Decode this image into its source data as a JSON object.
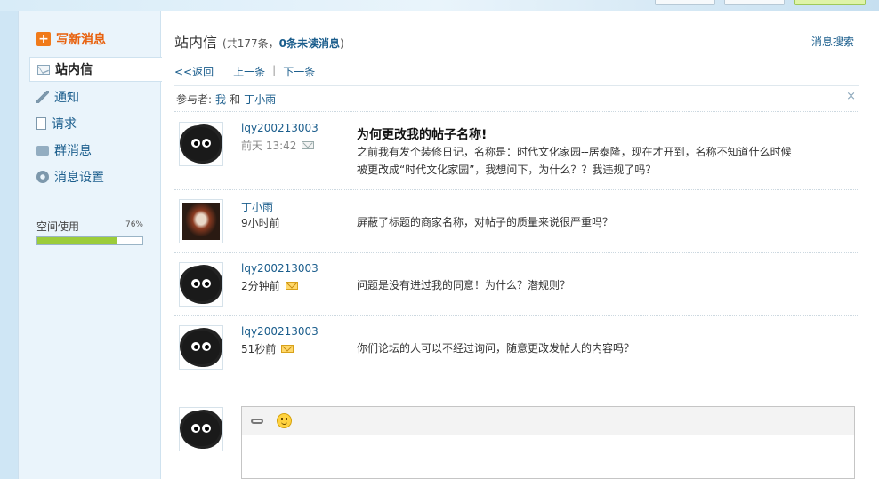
{
  "sidebar": {
    "compose_label": "写新消息",
    "items": [
      {
        "label": "站内信",
        "icon": "mail-icon",
        "active": true
      },
      {
        "label": "通知",
        "icon": "pencil-icon"
      },
      {
        "label": "请求",
        "icon": "document-icon"
      },
      {
        "label": "群消息",
        "icon": "chat-icon"
      },
      {
        "label": "消息设置",
        "icon": "settings-icon"
      }
    ],
    "usage": {
      "label": "空间使用",
      "percent_text": "76%",
      "percent": 0.76
    }
  },
  "main": {
    "title": "站内信",
    "count_prefix": "(共177条，",
    "unread_text": "0条未读消息",
    "count_suffix": ")",
    "search_link": "消息搜索",
    "pager": {
      "back": "<<返回",
      "prev": "上一条",
      "sep": "|",
      "next": "下一条"
    },
    "participants": {
      "label": "参与者:",
      "me": "我",
      "and": "和",
      "other": "丁小雨",
      "close": "×"
    },
    "messages": [
      {
        "sender": "lqy200213003",
        "time": "前天 13:42",
        "status": "read",
        "subject": "为何更改我的帖子名称!",
        "body": "之前我有发个装修日记，名称是：时代文化家园--居泰隆，现在才开到，名称不知道什么时候被更改成“时代文化家园”，我想问下，为什么？？我违规了吗？"
      },
      {
        "sender": "丁小雨",
        "time": "9小时前",
        "status": "none",
        "subject": "",
        "body": "屏蔽了标题的商家名称，对帖子的质量来说很严重吗？"
      },
      {
        "sender": "lqy200213003",
        "time": "2分钟前",
        "status": "unread",
        "subject": "",
        "body": "问题是没有进过我的同意！为什么？潜规则？"
      },
      {
        "sender": "lqy200213003",
        "time": "51秒前",
        "status": "unread",
        "subject": "",
        "body": "你们论坛的人可以不经过询问，随意更改发帖人的内容吗？"
      }
    ]
  },
  "editor": {
    "tools": [
      "link-icon",
      "smiley-icon"
    ]
  }
}
